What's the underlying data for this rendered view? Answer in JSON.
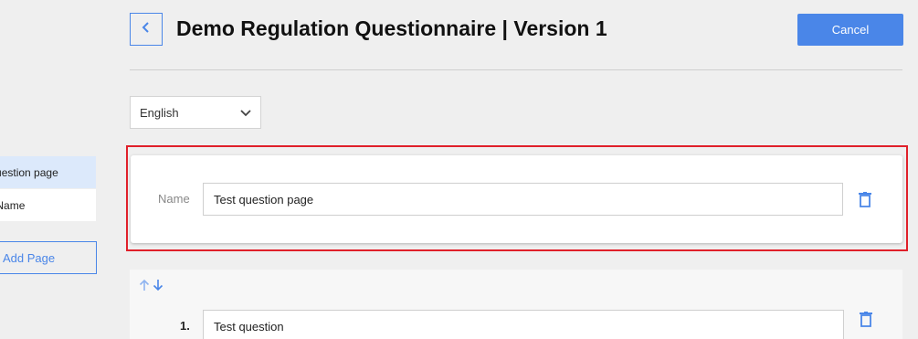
{
  "header": {
    "title": "Demo Regulation Questionnaire | Version 1",
    "cancel_label": "Cancel"
  },
  "sidebar": {
    "items": [
      {
        "label": "Test question page",
        "active": true
      },
      {
        "label": "Section Name",
        "active": false
      }
    ],
    "add_page_label": "Add Page"
  },
  "language": {
    "selected": "English"
  },
  "page_card": {
    "name_label": "Name",
    "name_value": "Test question page"
  },
  "question": {
    "number": "1.",
    "text": "Test question"
  },
  "colors": {
    "accent": "#4a86e8",
    "highlight": "#e0202a",
    "background": "#efefef"
  }
}
